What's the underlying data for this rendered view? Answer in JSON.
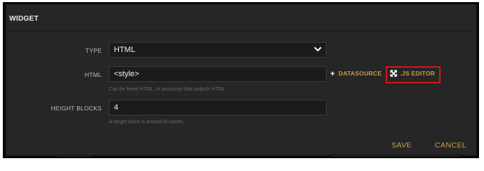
{
  "dialog": {
    "title": "WIDGET"
  },
  "form": {
    "type_label": "TYPE",
    "type_value": "HTML",
    "html_label": "HTML",
    "html_value": "<style>",
    "html_hint": "Can be literal HTML, or javascript that outputs HTML.",
    "height_label": "HEIGHT BLOCKS",
    "height_value": "4",
    "height_hint": "A height block is around 60 pixels."
  },
  "actions": {
    "datasource_label": "DATASOURCE",
    "js_editor_label": ".JS EDITOR"
  },
  "footer": {
    "save_label": "SAVE",
    "cancel_label": "CANCEL"
  },
  "colors": {
    "accent": "#c99a4a",
    "highlight_box": "#d01818",
    "dialog_bg": "#262626"
  },
  "icons": [
    "chevron-down-icon",
    "plus-icon",
    "expand-arrows-icon"
  ]
}
